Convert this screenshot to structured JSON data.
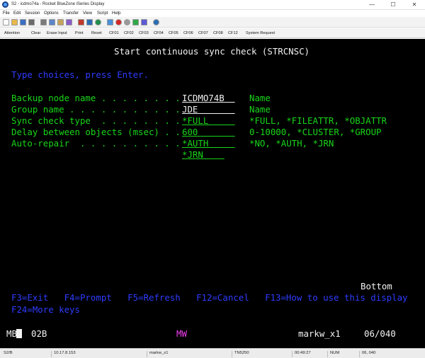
{
  "window": {
    "title": "S2 - icdmo74a - Rocket BlueZone iSeries Display",
    "controls": {
      "minimize": "—",
      "maximize": "☐",
      "close": "✕"
    }
  },
  "menu": [
    "File",
    "Edit",
    "Session",
    "Options",
    "Transfer",
    "View",
    "Script",
    "Help"
  ],
  "toolbar_icons": [
    {
      "name": "new-icon",
      "color": "#ffffff"
    },
    {
      "name": "open-icon",
      "color": "#e8b84a"
    },
    {
      "name": "save-icon",
      "color": "#3a6fc4"
    },
    {
      "name": "print-icon",
      "color": "#6b6b6b"
    },
    {
      "name": "cut-icon",
      "color": "#7a7a7a"
    },
    {
      "name": "copy-icon",
      "color": "#5c86c9"
    },
    {
      "name": "paste-icon",
      "color": "#c9a25c"
    },
    {
      "name": "edit-icon",
      "color": "#8a5cc9"
    },
    {
      "name": "font-icon",
      "color": "#c0392b"
    },
    {
      "name": "connect-icon",
      "color": "#2a6db5"
    },
    {
      "name": "globe-icon",
      "color": "#1f8f4e"
    },
    {
      "name": "transfer-icon",
      "color": "#4a90d9"
    },
    {
      "name": "record-icon",
      "color": "#d62424"
    },
    {
      "name": "stop-icon",
      "color": "#9a9a9a"
    },
    {
      "name": "play-icon",
      "color": "#2fa84a"
    },
    {
      "name": "macro-icon",
      "color": "#5b5bd6"
    },
    {
      "name": "help-icon",
      "color": "#2a6db5"
    }
  ],
  "keypad": [
    "Attention",
    "Clear",
    "Erase Input",
    "Print",
    "Reset",
    "CF01",
    "CF02",
    "CF03",
    "CF04",
    "CF05",
    "CF06",
    "CF07",
    "CF08",
    "CF12",
    "System Request"
  ],
  "terminal": {
    "title": "Start continuous sync check (STRCNSC)",
    "instruction": "Type choices, press Enter.",
    "fields": [
      {
        "label": "Backup node name . . . . . . . .",
        "value": "ICDMO74B  ",
        "hint": "Name"
      },
      {
        "label": "Group name . . . . . . . . . . .",
        "value": "JDE       ",
        "hint": "Name"
      },
      {
        "label": "Sync check type  . . . . . . . .",
        "value": "*FULL     ",
        "hint": "*FULL, *FILEATTR, *OBJATTR"
      },
      {
        "label": "Delay between objects (msec) . .",
        "value": "600       ",
        "hint": "0-10000, *CLUSTER, *GROUP"
      },
      {
        "label": "Auto-repair  . . . . . . . . . .",
        "value": "*AUTH     ",
        "hint": "*NO, *AUTH, *JRN"
      }
    ],
    "extra_value": "*JRN    ",
    "bottom": "Bottom",
    "fkeys_line1": "F3=Exit   F4=Prompt   F5=Refresh   F12=Cancel   F13=How to use this display",
    "fkeys_line2": "F24=More keys"
  },
  "oia": {
    "mode": "MB",
    "session": "02B",
    "mw": "MW",
    "user": "markw_x1",
    "position": "06/040"
  },
  "statusbar": {
    "session": "S2/B",
    "ip": "10.17.8.153",
    "user": "markw_x1",
    "mode": "TN5250",
    "time": "00:49:27",
    "num": "NUM",
    "cursor": "06, 040"
  },
  "colors": {
    "screen_bg": "#000000",
    "green": "#19d619",
    "blue": "#2e3cff",
    "white": "#f2f2f2",
    "pink": "#f03ef0"
  }
}
